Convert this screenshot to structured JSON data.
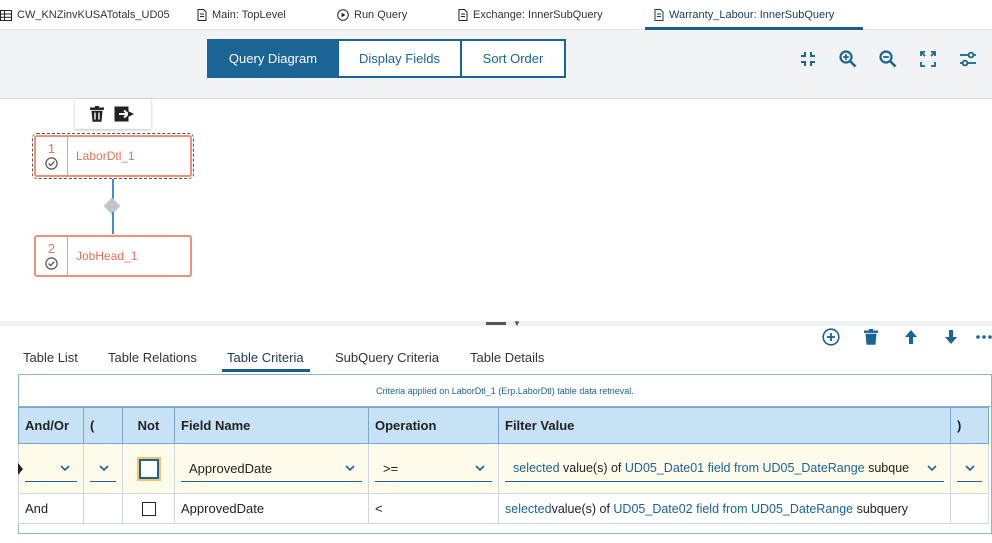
{
  "tabs": [
    {
      "label": "CW_KNZinvKUSATotals_UD05",
      "icon": "table-icon"
    },
    {
      "label": "Main: TopLevel",
      "icon": "document-icon"
    },
    {
      "label": "Run Query",
      "icon": "play-icon"
    },
    {
      "label": "Exchange: InnerSubQuery",
      "icon": "document-icon"
    },
    {
      "label": "Warranty_Labour: InnerSubQuery",
      "icon": "document-icon",
      "active": true
    }
  ],
  "toolbar": {
    "segments": [
      {
        "label": "Query Diagram",
        "active": true
      },
      {
        "label": "Display Fields",
        "active": false
      },
      {
        "label": "Sort Order",
        "active": false
      }
    ],
    "icons": [
      "collapse-icon",
      "zoom-in-icon",
      "zoom-out-icon",
      "fit-screen-icon",
      "settings-sliders-icon"
    ]
  },
  "diagram": {
    "mini_toolbar": [
      "trash-icon",
      "move-out-icon"
    ],
    "nodes": [
      {
        "num": "1",
        "name": "LaborDtl_1",
        "selected": true
      },
      {
        "num": "2",
        "name": "JobHead_1",
        "selected": false
      }
    ]
  },
  "actions": [
    "add-circle-icon",
    "trash-icon",
    "arrow-up-icon",
    "arrow-down-icon",
    "more-icon"
  ],
  "subtabs": [
    {
      "label": "Table List"
    },
    {
      "label": "Table Relations"
    },
    {
      "label": "Table Criteria",
      "active": true
    },
    {
      "label": "SubQuery Criteria"
    },
    {
      "label": "Table Details"
    }
  ],
  "criteria": {
    "caption": "Criteria applied on LaborDtl_1 (Erp.LaborDtl) table data retrieval.",
    "headers": [
      "And/Or",
      "(",
      "Not",
      "Field Name",
      "Operation",
      "Filter Value",
      ")"
    ],
    "rows": [
      {
        "andor": "",
        "paren_open": "",
        "not": false,
        "field": "ApprovedDate",
        "operation": ">=",
        "filter": {
          "pre": "selected",
          "mid": "value(s) of",
          "link": "UD05_Date01 field from UD05_DateRange",
          "post": "subque"
        },
        "paren_close": ""
      },
      {
        "andor": "And",
        "paren_open": "",
        "not": false,
        "field": "ApprovedDate",
        "operation": "<",
        "filter": {
          "pre": "selected",
          "mid": "value(s) of",
          "link": "UD05_Date02 field from UD05_DateRange",
          "post": "subquery"
        },
        "paren_close": ""
      }
    ]
  },
  "colors": {
    "accent": "#1a6496",
    "node_border": "#f0907a",
    "node_text": "#e0735c",
    "header_bg": "#c8e2f5",
    "edit_row_bg": "#fffbeb"
  }
}
